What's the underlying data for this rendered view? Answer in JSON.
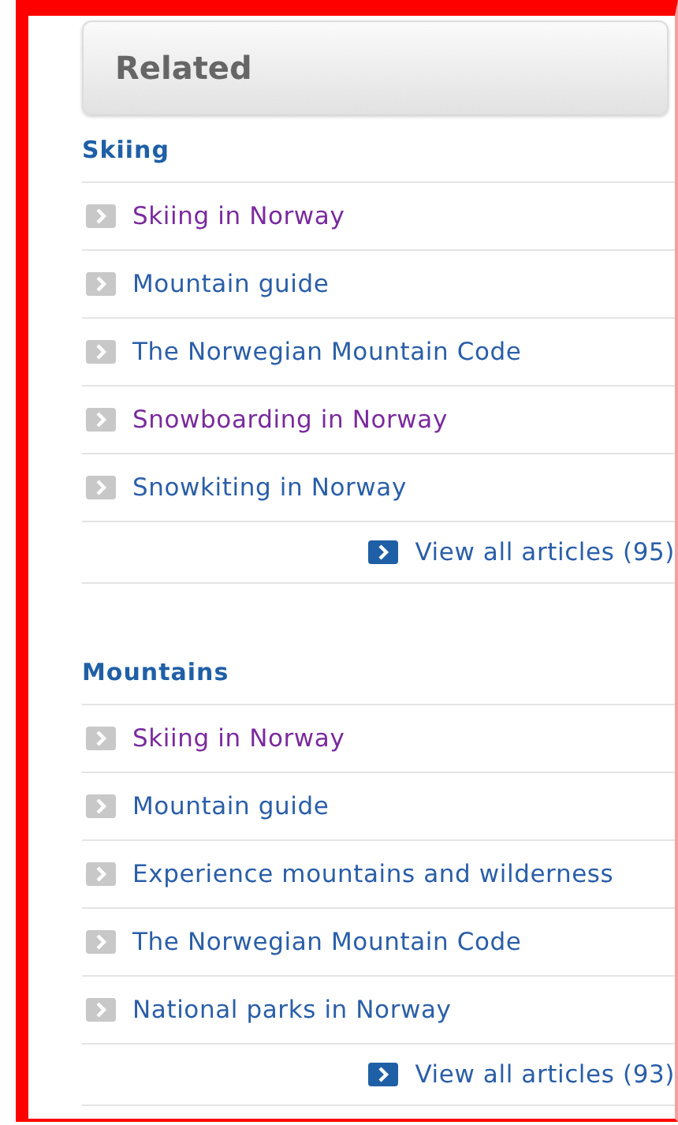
{
  "panel": {
    "title": "Related"
  },
  "sections": [
    {
      "title": "Skiing",
      "links": [
        {
          "label": "Skiing in Norway",
          "visited": true
        },
        {
          "label": "Mountain guide",
          "visited": false
        },
        {
          "label": "The Norwegian Mountain Code",
          "visited": false
        },
        {
          "label": "Snowboarding in Norway",
          "visited": true
        },
        {
          "label": "Snowkiting in Norway",
          "visited": false
        }
      ],
      "view_all": "View all articles (95)"
    },
    {
      "title": "Mountains",
      "links": [
        {
          "label": "Skiing in Norway",
          "visited": true
        },
        {
          "label": "Mountain guide",
          "visited": false
        },
        {
          "label": "Experience mountains and wilderness",
          "visited": false
        },
        {
          "label": "The Norwegian Mountain Code",
          "visited": false
        },
        {
          "label": "National parks in Norway",
          "visited": false
        }
      ],
      "view_all": "View all articles (93)"
    }
  ]
}
